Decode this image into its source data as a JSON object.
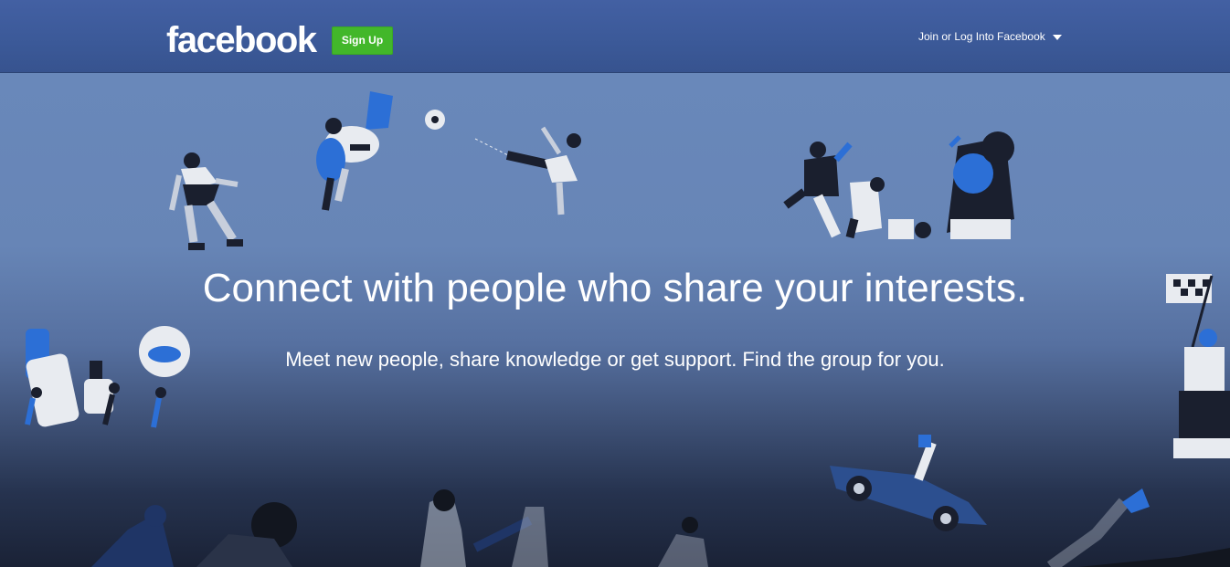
{
  "header": {
    "logo_text": "facebook",
    "signup_label": "Sign Up",
    "join_label": "Join or Log Into Facebook",
    "join_icon": "chevron-down-icon"
  },
  "hero": {
    "headline": "Connect with people who share your interests.",
    "subline": "Meet new people, share knowledge or get support. Find the group for you."
  },
  "colors": {
    "brand_blue": "#3b5998",
    "signup_green": "#42b72a",
    "hero_top": "#6988ba",
    "hero_bottom": "#1a2236"
  }
}
